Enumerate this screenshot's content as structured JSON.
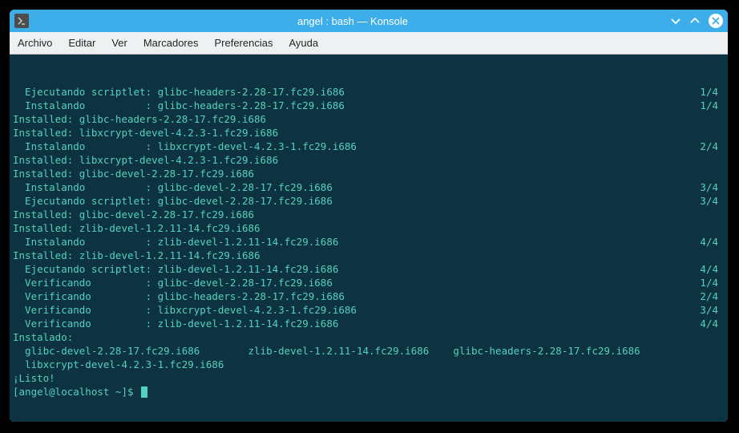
{
  "titlebar": {
    "title": "angel : bash — Konsole"
  },
  "menubar": {
    "items": [
      "Archivo",
      "Editar",
      "Ver",
      "Marcadores",
      "Preferencias",
      "Ayuda"
    ]
  },
  "terminal": {
    "lines": [
      {
        "left": "  Ejecutando scriptlet: glibc-headers-2.28-17.fc29.i686",
        "right": "1/4"
      },
      {
        "left": "  Instalando          : glibc-headers-2.28-17.fc29.i686",
        "right": "1/4"
      },
      {
        "left": "Installed: glibc-headers-2.28-17.fc29.i686",
        "right": ""
      },
      {
        "left": "Installed: libxcrypt-devel-4.2.3-1.fc29.i686",
        "right": ""
      },
      {
        "left": "  Instalando          : libxcrypt-devel-4.2.3-1.fc29.i686",
        "right": "2/4"
      },
      {
        "left": "Installed: libxcrypt-devel-4.2.3-1.fc29.i686",
        "right": ""
      },
      {
        "left": "Installed: glibc-devel-2.28-17.fc29.i686",
        "right": ""
      },
      {
        "left": "  Instalando          : glibc-devel-2.28-17.fc29.i686",
        "right": "3/4"
      },
      {
        "left": "  Ejecutando scriptlet: glibc-devel-2.28-17.fc29.i686",
        "right": "3/4"
      },
      {
        "left": "Installed: glibc-devel-2.28-17.fc29.i686",
        "right": ""
      },
      {
        "left": "Installed: zlib-devel-1.2.11-14.fc29.i686",
        "right": ""
      },
      {
        "left": "  Instalando          : zlib-devel-1.2.11-14.fc29.i686",
        "right": "4/4"
      },
      {
        "left": "Installed: zlib-devel-1.2.11-14.fc29.i686",
        "right": ""
      },
      {
        "left": "  Ejecutando scriptlet: zlib-devel-1.2.11-14.fc29.i686",
        "right": "4/4"
      },
      {
        "left": "  Verificando         : glibc-devel-2.28-17.fc29.i686",
        "right": "1/4"
      },
      {
        "left": "  Verificando         : glibc-headers-2.28-17.fc29.i686",
        "right": "2/4"
      },
      {
        "left": "  Verificando         : libxcrypt-devel-4.2.3-1.fc29.i686",
        "right": "3/4"
      },
      {
        "left": "  Verificando         : zlib-devel-1.2.11-14.fc29.i686",
        "right": "4/4"
      },
      {
        "left": "",
        "right": ""
      },
      {
        "left": "Instalado:",
        "right": ""
      },
      {
        "left": "  glibc-devel-2.28-17.fc29.i686        zlib-devel-1.2.11-14.fc29.i686    glibc-headers-2.28-17.fc29.i686",
        "right": ""
      },
      {
        "left": "  libxcrypt-devel-4.2.3-1.fc29.i686",
        "right": ""
      },
      {
        "left": "",
        "right": ""
      },
      {
        "left": "¡Listo!",
        "right": ""
      }
    ],
    "prompt": "[angel@localhost ~]$ "
  }
}
